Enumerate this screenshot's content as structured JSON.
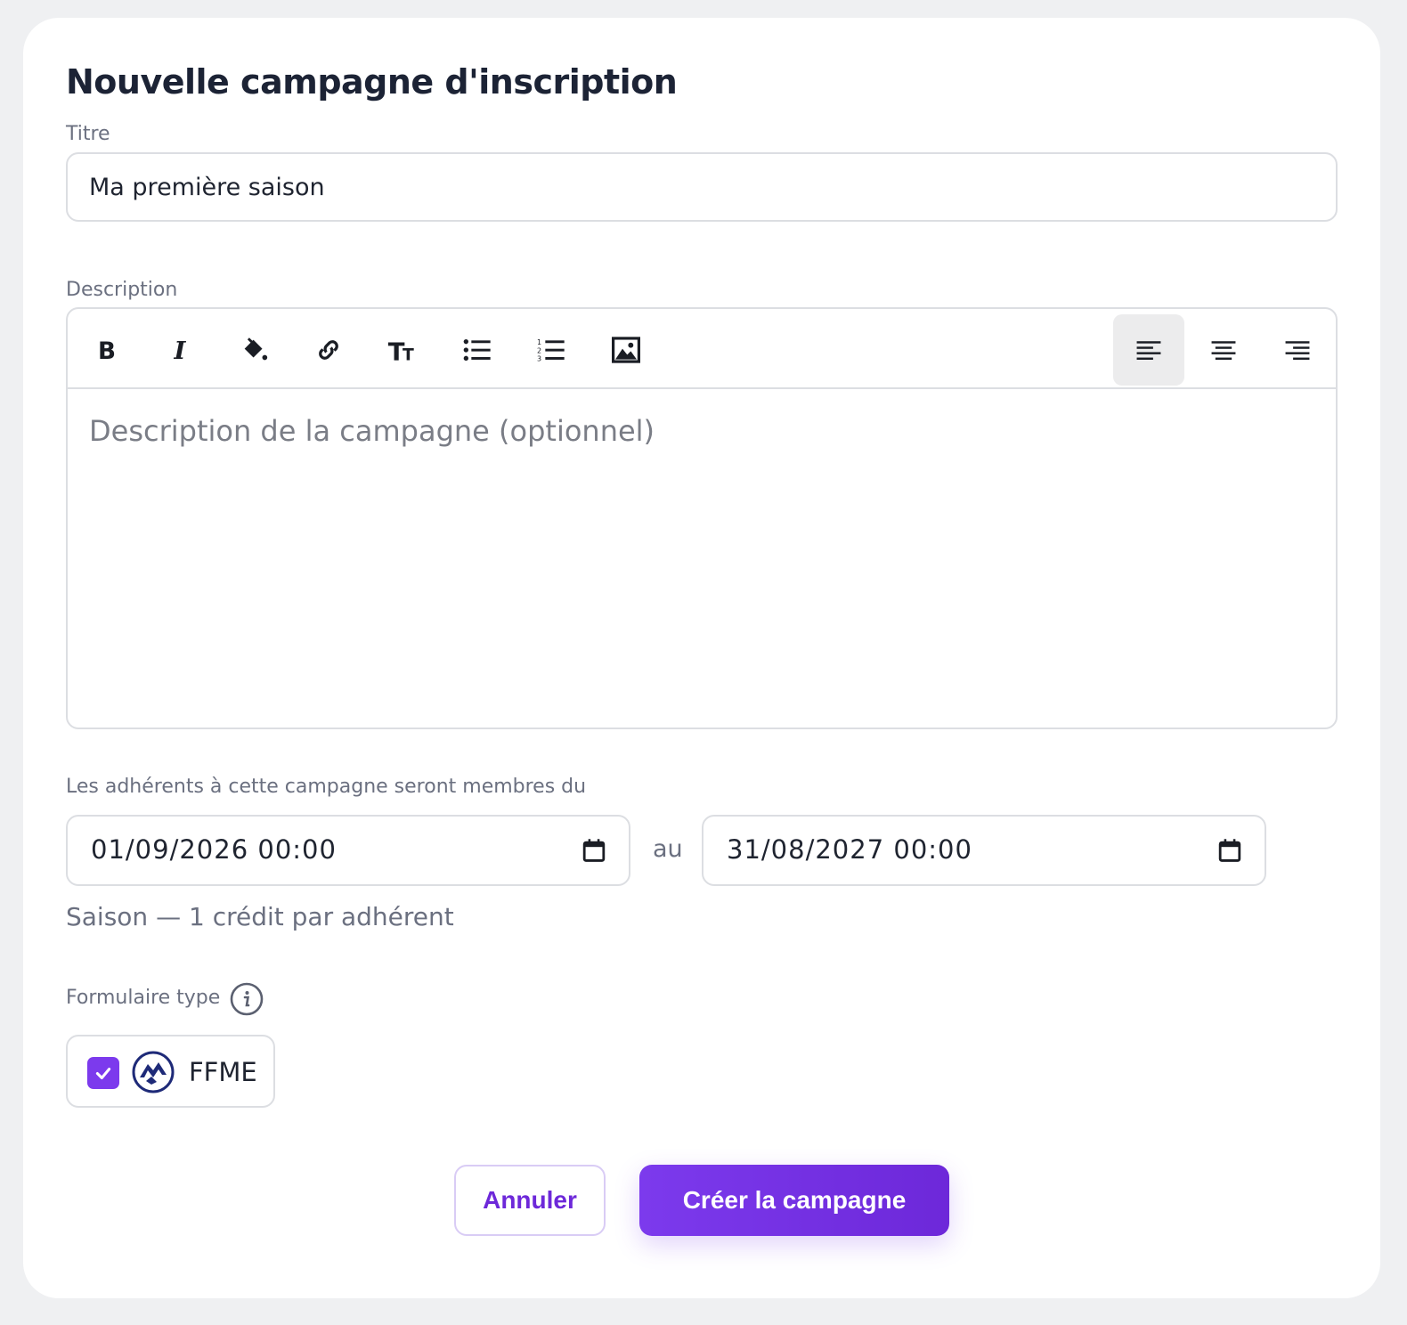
{
  "form": {
    "heading": "Nouvelle campagne d'inscription",
    "title_label": "Titre",
    "title_value": "Ma première saison",
    "description_label": "Description",
    "description_placeholder": "Description de la campagne (optionnel)",
    "toolbar": {
      "buttons": [
        "bold-icon",
        "italic-icon",
        "fill-color-icon",
        "link-icon",
        "text-size-icon",
        "bullet-list-icon",
        "numbered-list-icon",
        "image-icon",
        "align-left-icon",
        "align-center-icon",
        "align-right-icon"
      ],
      "active": "align-left-icon"
    },
    "membership_label": "Les adhérents à cette campagne seront membres du",
    "start_date": "01/09/2026 00:00",
    "date_separator": "au",
    "end_date": "31/08/2027 00:00",
    "season_info": "Saison — 1 crédit par adhérent",
    "form_type_label": "Formulaire type",
    "form_type_option": {
      "label": "FFME",
      "checked": true
    }
  },
  "actions": {
    "cancel_label": "Annuler",
    "create_label": "Créer la campagne"
  },
  "colors": {
    "accent": "#7c3aed",
    "accent_dark": "#6d28d9",
    "logo_navy": "#1e2a78"
  }
}
